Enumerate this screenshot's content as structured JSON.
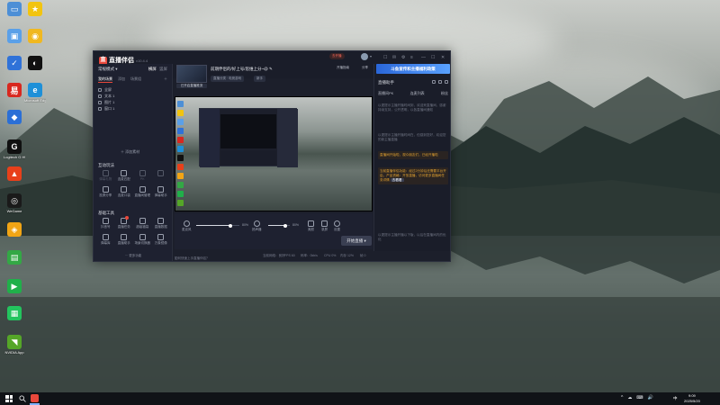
{
  "desktop": {
    "icons": [
      {
        "label": "",
        "color": "#4d8fd6",
        "glyph": "▭"
      },
      {
        "label": "",
        "color": "#f2c40f",
        "glyph": "★"
      },
      {
        "label": "",
        "color": "#5aa0e8",
        "glyph": "▣"
      },
      {
        "label": "",
        "color": "#f0b820",
        "glyph": "◉"
      },
      {
        "label": "",
        "color": "#2f72d8",
        "glyph": "✓"
      },
      {
        "label": "",
        "color": "#111111",
        "glyph": "◐"
      },
      {
        "label": "",
        "color": "#d8281f",
        "glyph": "易"
      },
      {
        "label": "Microsoft Edge",
        "color": "#1e90d8",
        "glyph": "e"
      },
      {
        "label": "",
        "color": "#2b6fd6",
        "glyph": "◆"
      },
      {
        "label": "Logitech G HUB",
        "color": "#101010",
        "glyph": "G"
      },
      {
        "label": "",
        "color": "#e8401a",
        "glyph": "▲"
      },
      {
        "label": "WeGame",
        "color": "#1a1a1a",
        "glyph": "◎"
      },
      {
        "label": "",
        "color": "#f2a515",
        "glyph": "◈"
      },
      {
        "label": "",
        "color": "#33a845",
        "glyph": "▤"
      },
      {
        "label": "",
        "color": "#20b04a",
        "glyph": "▶"
      },
      {
        "label": "",
        "color": "#23c45e",
        "glyph": "▦"
      },
      {
        "label": "NVIDIA App",
        "color": "#55a628",
        "glyph": "◥"
      }
    ]
  },
  "app": {
    "name": "直播伴侣",
    "version": "v10.4.4",
    "header": {
      "live_pill": "去开播",
      "buttons": [
        "开播指南",
        "分享"
      ]
    },
    "left": {
      "scene_header": "常规模式",
      "scene_header_right": [
        "横屏",
        "竖屏"
      ],
      "tabs": [
        "我的场景",
        "添加",
        "场景组"
      ],
      "scenes": [
        "全屏",
        "文本 1",
        "图片 1",
        "窗口 1"
      ],
      "add_material": "添加素材",
      "interact_title": "互动玩法",
      "interact_tools": [
        {
          "label": "弹幕礼物",
          "dim": true
        },
        {
          "label": "连麦匹配",
          "dim": false
        },
        {
          "label": "PK",
          "dim": true
        },
        {
          "label": "",
          "dim": true
        },
        {
          "label": "投屏分享",
          "dim": false
        },
        {
          "label": "连麦口袋",
          "dim": false
        },
        {
          "label": "直播间管理",
          "dim": false
        },
        {
          "label": "弹幕助手",
          "dim": false
        }
      ],
      "basic_title": "基础工具",
      "basic_tools": [
        {
          "label": "抖音号",
          "badge": false
        },
        {
          "label": "直播任务",
          "badge": true
        },
        {
          "label": "超级福袋",
          "badge": false
        },
        {
          "label": "直播数据",
          "badge": false
        },
        {
          "label": "弹幕库",
          "badge": false
        },
        {
          "label": "直播助手",
          "badge": false
        },
        {
          "label": "场景切换器",
          "badge": false
        },
        {
          "label": "万象镜像",
          "badge": false
        }
      ],
      "more": "更多功能"
    },
    "center": {
      "thumb_caption": "已开启直播推流",
      "title": "前期伴侣的/好上号/思维上分~@",
      "pills": [
        "直播分类 · 电竞游戏",
        "新手"
      ],
      "controls": {
        "mic_label": "麦克风",
        "mic_pct": "80%",
        "speaker_label": "扬声器",
        "speaker_pct": "80%",
        "effects_label": "美颜",
        "record_label": "录屏",
        "settings_label": "设置",
        "start_btn": "开始直播"
      },
      "mic_level": 0.8,
      "speaker_level": 0.8,
      "status": {
        "help": "如何快速上手直播伴侣？",
        "items": [
          "当前网络：良好",
          "FPS 60",
          "码率：0kb/s",
          "CPU 0%",
          "内存 12%",
          "帧 0"
        ]
      }
    },
    "right": {
      "banner": "斗鱼宣传和主播福利政策",
      "assist_title": "直播助手",
      "tabs": [
        "直播间PK",
        "连麦列表",
        "粉丝"
      ],
      "msgs": [
        "以更提示主播开播时间到，欢迎来直播间，感谢持续支持，公开透明，以各直播间通知",
        "以更提示主播开播时间在，但感到您好，欢迎您的新主播直播",
        "直播间开始啦，观众朋友们，已经开播啦",
        "当前直播伴侣功能：经过2分钟后还需要平台开启，产品资格：开放直播，访问更多直播间任务详情",
        "以更提示主播开播以下版，以后在直播间内的优化"
      ],
      "link": "去看看"
    }
  },
  "taskbar": {
    "tray": [
      "^",
      "☁",
      "⌨",
      "🔊"
    ],
    "ime": "中",
    "time": "9:09",
    "date": "2025/5/20"
  }
}
